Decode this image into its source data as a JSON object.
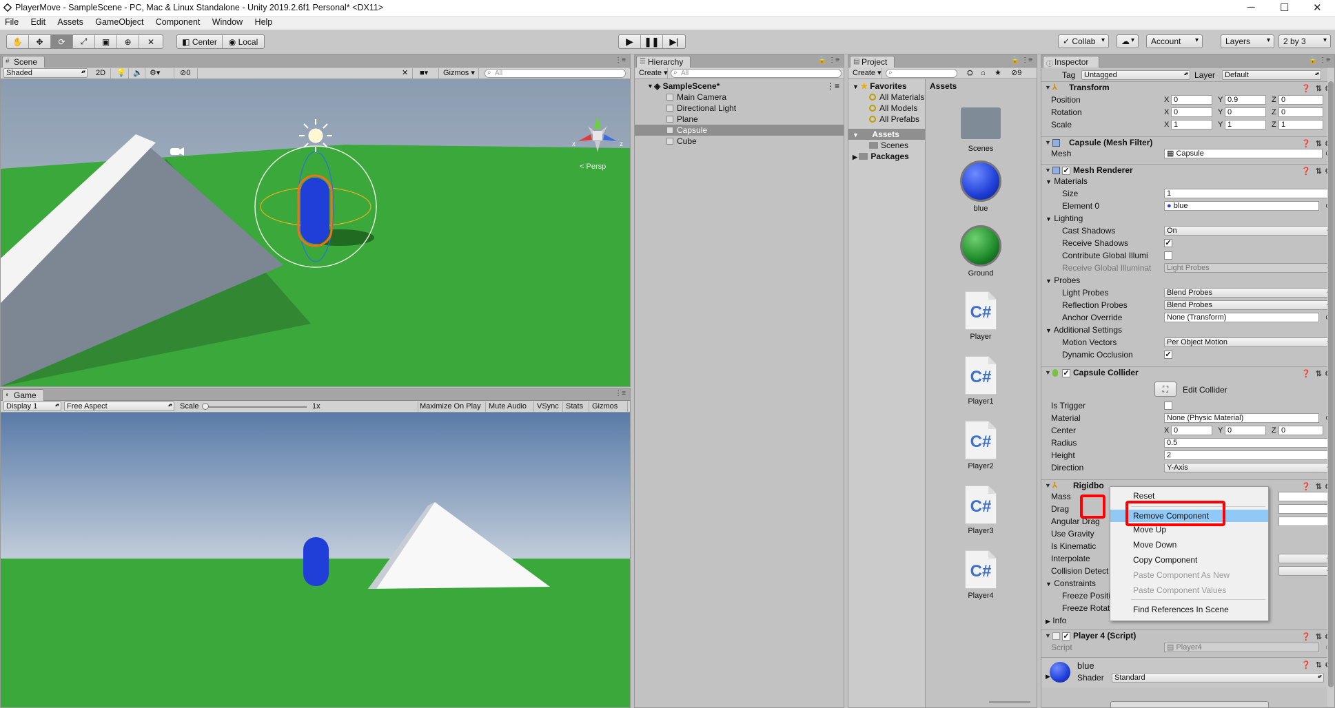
{
  "window": {
    "title": "PlayerMove - SampleScene - PC, Mac & Linux Standalone - Unity 2019.2.6f1 Personal* <DX11>",
    "controls": {
      "minimize": "─",
      "maximize": "☐",
      "close": "✕"
    }
  },
  "menu": [
    "File",
    "Edit",
    "Assets",
    "GameObject",
    "Component",
    "Window",
    "Help"
  ],
  "toolbar": {
    "tools": [
      "hand-icon",
      "move-icon",
      "rotate-icon",
      "scale-icon",
      "rect-icon",
      "transform-icon",
      "custom-tool-icon"
    ],
    "pivot": "Center",
    "space": "Local",
    "collab": "Collab",
    "account": "Account",
    "layers": "Layers",
    "layout": "2 by 3"
  },
  "scene": {
    "tab": "Scene",
    "shading": "Shaded",
    "mode2d": "2D",
    "hidden_count": "0",
    "gizmos": "Gizmos",
    "search_placeholder": "All",
    "persp": "Persp",
    "gizmo_x": "x",
    "gizmo_z": "z"
  },
  "game": {
    "tab": "Game",
    "display": "Display 1",
    "aspect": "Free Aspect",
    "scale_label": "Scale",
    "scale_value": "1x",
    "buttons": [
      "Maximize On Play",
      "Mute Audio",
      "VSync",
      "Stats",
      "Gizmos"
    ]
  },
  "hierarchy": {
    "tab": "Hierarchy",
    "create": "Create",
    "search_placeholder": "All",
    "scene": "SampleScene*",
    "items": [
      "Main Camera",
      "Directional Light",
      "Plane",
      "Capsule",
      "Cube"
    ],
    "selected": "Capsule"
  },
  "project": {
    "tab": "Project",
    "create": "Create",
    "hidden_count": "9",
    "favorites": "Favorites",
    "fav_items": [
      "All Materials",
      "All Models",
      "All Prefabs"
    ],
    "assets_root": "Assets",
    "asset_folders": [
      "Scenes"
    ],
    "packages": "Packages",
    "assets_header": "Assets",
    "assets": [
      {
        "name": "Scenes",
        "kind": "folder"
      },
      {
        "name": "blue",
        "kind": "material",
        "color": "#1f3fd8"
      },
      {
        "name": "Ground",
        "kind": "material",
        "color": "#1e8a2a"
      },
      {
        "name": "Player",
        "kind": "script"
      },
      {
        "name": "Player1",
        "kind": "script"
      },
      {
        "name": "Player2",
        "kind": "script"
      },
      {
        "name": "Player3",
        "kind": "script"
      },
      {
        "name": "Player4",
        "kind": "script"
      }
    ],
    "script_glyph": "C#"
  },
  "inspector": {
    "tab": "Inspector",
    "tag_label": "Tag",
    "tag_value": "Untagged",
    "layer_label": "Layer",
    "layer_value": "Default",
    "transform": {
      "title": "Transform",
      "position": {
        "label": "Position",
        "x": "0",
        "y": "0.9",
        "z": "0"
      },
      "rotation": {
        "label": "Rotation",
        "x": "0",
        "y": "0",
        "z": "0"
      },
      "scale": {
        "label": "Scale",
        "x": "1",
        "y": "1",
        "z": "1"
      }
    },
    "mesh_filter": {
      "title": "Capsule (Mesh Filter)",
      "mesh_label": "Mesh",
      "mesh_value": "Capsule"
    },
    "mesh_renderer": {
      "title": "Mesh Renderer",
      "materials": "Materials",
      "size_label": "Size",
      "size_value": "1",
      "element0_label": "Element 0",
      "element0_value": "blue",
      "lighting": "Lighting",
      "cast_shadows_label": "Cast Shadows",
      "cast_shadows_value": "On",
      "receive_shadows_label": "Receive Shadows",
      "contribute_gi_label": "Contribute Global Illumi",
      "receive_gi_label": "Receive Global Illuminat",
      "receive_gi_value": "Light Probes",
      "probes": "Probes",
      "light_probes_label": "Light Probes",
      "light_probes_value": "Blend Probes",
      "reflection_probes_label": "Reflection Probes",
      "reflection_probes_value": "Blend Probes",
      "anchor_override_label": "Anchor Override",
      "anchor_override_value": "None (Transform)",
      "additional": "Additional Settings",
      "motion_vectors_label": "Motion Vectors",
      "motion_vectors_value": "Per Object Motion",
      "dynamic_occlusion_label": "Dynamic Occlusion"
    },
    "capsule_collider": {
      "title": "Capsule Collider",
      "edit_collider": "Edit Collider",
      "is_trigger_label": "Is Trigger",
      "material_label": "Material",
      "material_value": "None (Physic Material)",
      "center_label": "Center",
      "cx": "0",
      "cy": "0",
      "cz": "0",
      "radius_label": "Radius",
      "radius_value": "0.5",
      "height_label": "Height",
      "height_value": "2",
      "direction_label": "Direction",
      "direction_value": "Y-Axis"
    },
    "rigidbody": {
      "title": "Rigidbo",
      "rows": [
        "Mass",
        "Drag",
        "Angular Drag",
        "Use Gravity",
        "Is Kinematic",
        "Interpolate",
        "Collision Detect",
        "Constraints",
        "Freeze Positic",
        "Freeze Rotati",
        "Info"
      ]
    },
    "player4": {
      "title": "Player 4 (Script)",
      "script_label": "Script",
      "script_value": "Player4"
    },
    "material": {
      "name": "blue",
      "shader_label": "Shader",
      "shader_value": "Standard"
    }
  },
  "context_menu": {
    "items": [
      {
        "label": "Reset",
        "state": "normal"
      },
      {
        "label": "Remove Component",
        "state": "selected"
      },
      {
        "label": "Move Up",
        "state": "normal"
      },
      {
        "label": "Move Down",
        "state": "normal"
      },
      {
        "label": "Copy Component",
        "state": "normal"
      },
      {
        "label": "Paste Component As New",
        "state": "disabled"
      },
      {
        "label": "Paste Component Values",
        "state": "disabled"
      },
      {
        "label": "Find References In Scene",
        "state": "normal"
      }
    ]
  },
  "colors": {
    "highlight_red": "#ff0000",
    "menu_selection": "#90c8f6",
    "ground_green": "#3aa83a",
    "capsule_blue": "#1f3fd8"
  }
}
